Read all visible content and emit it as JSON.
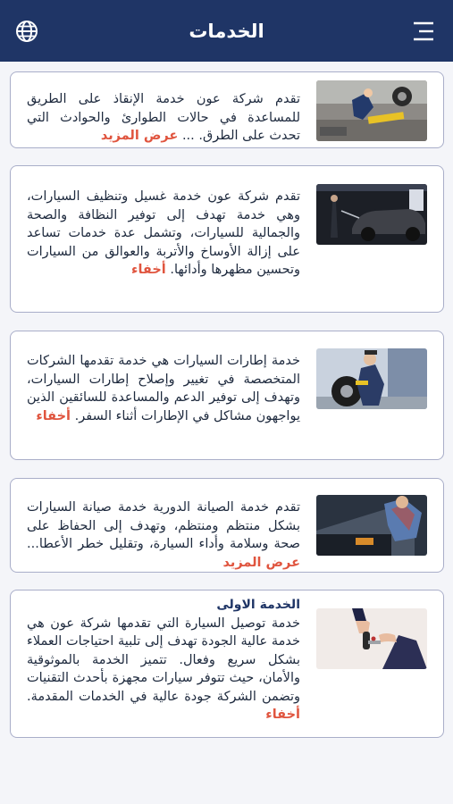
{
  "header": {
    "title": "الخدمات",
    "menu_icon": "menu-icon",
    "language_icon": "globe-icon",
    "background": "#1f3566"
  },
  "colors": {
    "accent_link": "#e0553f",
    "card_border": "#a9aec9",
    "text": "#1e2a3e"
  },
  "services": [
    {
      "title": "",
      "description": "تقدم شركة عون خدمة الإنقاذ على الطريق للمساعدة في حالات الطوارئ والحوادث التي تحدث على الطرق. ...",
      "toggle_label": "عرض المزيد",
      "image": "roadside-assistance-photo"
    },
    {
      "title": "",
      "description": "تقدم شركة عون خدمة غسيل وتنظيف السيارات، وهي خدمة تهدف إلى توفير النظافة والصحة والجمالية للسيارات، وتشمل عدة خدمات تساعد على إزالة الأوساخ والأتربة والعوالق من السيارات وتحسين مظهرها وأدائها.",
      "toggle_label": "أخفاء",
      "image": "car-wash-photo"
    },
    {
      "title": "",
      "description": "خدمة إطارات السيارات هي خدمة تقدمها الشركات المتخصصة في تغيير وإصلاح إطارات السيارات، وتهدف إلى توفير الدعم والمساعدة للسائقين الذين يواجهون مشاكل في الإطارات أثناء السفر.",
      "toggle_label": "أخفاء",
      "image": "tire-service-photo"
    },
    {
      "title": "",
      "description": "تقدم خدمة الصيانة الدورية خدمة صيانة السيارات بشكل منتظم ومنتظم، وتهدف إلى الحفاظ على صحة وسلامة وأداء السيارة، وتقليل خطر الأعطا...",
      "toggle_label": "عرض المزيد",
      "image": "periodic-maintenance-photo"
    },
    {
      "title": "الخدمة الاولى",
      "description": "خدمة توصيل السيارة التي تقدمها شركة عون هي خدمة عالية الجودة تهدف إلى تلبية احتياجات العملاء بشكل سريع وفعال. تتميز الخدمة بالموثوقية والأمان، حيث تتوفر سيارات مجهزة بأحدث التقنيات وتضمن الشركة جودة عالية في الخدمات المقدمة.",
      "toggle_label": "أخفاء",
      "image": "car-delivery-keys-photo"
    }
  ]
}
